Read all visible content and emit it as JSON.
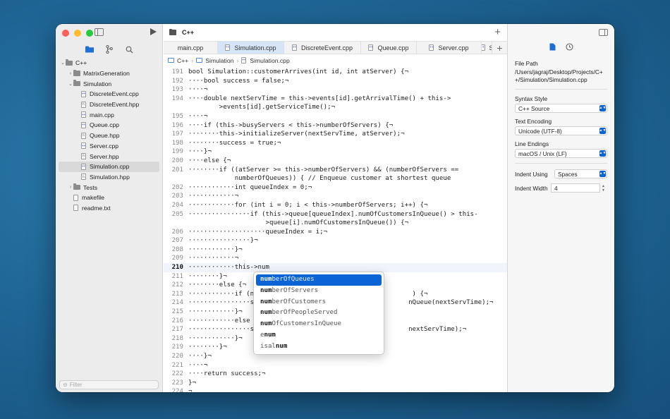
{
  "sidebar": {
    "filter_placeholder": "Filter",
    "tree": [
      {
        "label": "C++",
        "indent": 0,
        "chev": "⌄",
        "type": "folder",
        "name": "tree-folder-cpp"
      },
      {
        "label": "MatrixGeneration",
        "indent": 1,
        "chev": "›",
        "type": "folder",
        "name": "tree-folder-matrixgeneration"
      },
      {
        "label": "Simulation",
        "indent": 1,
        "chev": "⌄",
        "type": "folder",
        "name": "tree-folder-simulation"
      },
      {
        "label": "DiscreteEvent.cpp",
        "indent": 2,
        "type": "cpp",
        "name": "tree-file-discreteevent-cpp"
      },
      {
        "label": "DiscreteEvent.hpp",
        "indent": 2,
        "type": "h",
        "name": "tree-file-discreteevent-hpp"
      },
      {
        "label": "main.cpp",
        "indent": 2,
        "type": "cpp",
        "name": "tree-file-main-cpp"
      },
      {
        "label": "Queue.cpp",
        "indent": 2,
        "type": "cpp",
        "name": "tree-file-queue-cpp"
      },
      {
        "label": "Queue.hpp",
        "indent": 2,
        "type": "h",
        "name": "tree-file-queue-hpp"
      },
      {
        "label": "Server.cpp",
        "indent": 2,
        "type": "cpp",
        "name": "tree-file-server-cpp"
      },
      {
        "label": "Server.hpp",
        "indent": 2,
        "type": "h",
        "name": "tree-file-server-hpp"
      },
      {
        "label": "Simulation.cpp",
        "indent": 2,
        "type": "cpp",
        "selected": true,
        "name": "tree-file-simulation-cpp"
      },
      {
        "label": "Simulation.hpp",
        "indent": 2,
        "type": "h",
        "name": "tree-file-simulation-hpp"
      },
      {
        "label": "Tests",
        "indent": 1,
        "chev": "›",
        "type": "folder",
        "name": "tree-folder-tests"
      },
      {
        "label": "makefile",
        "indent": 1,
        "type": "plain",
        "name": "tree-file-makefile"
      },
      {
        "label": "readme.txt",
        "indent": 1,
        "type": "plain",
        "name": "tree-file-readme"
      }
    ]
  },
  "editor": {
    "project_title": "C++",
    "tabs": [
      {
        "label": "main.cpp",
        "width": 77,
        "active": false,
        "icon": false
      },
      {
        "label": "Simulation.cpp",
        "width": 94,
        "active": true,
        "icon": true
      },
      {
        "label": "DiscreteEvent.cpp",
        "width": 109,
        "active": false,
        "icon": true
      },
      {
        "label": "Queue.cpp",
        "width": 79,
        "active": false,
        "icon": true
      },
      {
        "label": "Server.cpp",
        "width": 92,
        "active": false,
        "icon": true
      },
      {
        "label": "S",
        "width": 15,
        "active": false,
        "icon": true
      }
    ],
    "breadcrumb": [
      "C++",
      "Simulation",
      "Simulation.cpp"
    ],
    "current_line": "210",
    "lines": [
      {
        "n": "191",
        "t": "bool Simulation::customerArrives(int id, int atServer) {¬"
      },
      {
        "n": "192",
        "t": "····bool success = false;¬"
      },
      {
        "n": "193",
        "t": "····¬"
      },
      {
        "n": "194",
        "t": "····double nextServTime = this->events[id].getArrivalTime() + this->"
      },
      {
        "n": "",
        "t": "        >events[id].getServiceTime();¬"
      },
      {
        "n": "195",
        "t": "····¬"
      },
      {
        "n": "196",
        "t": "····if (this->busyServers < this->numberOfServers) {¬"
      },
      {
        "n": "197",
        "t": "········this->initializeServer(nextServTime, atServer);¬"
      },
      {
        "n": "198",
        "t": "········success = true;¬"
      },
      {
        "n": "199",
        "t": "····}¬"
      },
      {
        "n": "200",
        "t": "····else {¬"
      },
      {
        "n": "201",
        "t": "········if ((atServer >= this->numberOfServers) && (numberOfServers =="
      },
      {
        "n": "",
        "t": "            numberOfQueues)) { // Enqueue customer at shortest queue"
      },
      {
        "n": "202",
        "t": "············int queueIndex = 0;¬"
      },
      {
        "n": "203",
        "t": "············¬"
      },
      {
        "n": "204",
        "t": "············for (int i = 0; i < this->numberOfServers; i++) {¬"
      },
      {
        "n": "205",
        "t": "················if (this->queue[queueIndex].numOfCustomersInQueue() > this-"
      },
      {
        "n": "",
        "t": "                    >queue[i].numOfCustomersInQueue()) {¬"
      },
      {
        "n": "206",
        "t": "····················queueIndex = i;¬"
      },
      {
        "n": "207",
        "t": "················}¬"
      },
      {
        "n": "208",
        "t": "············}¬"
      },
      {
        "n": "209",
        "t": "············¬"
      },
      {
        "n": "210",
        "t": "············this->num"
      },
      {
        "n": "211",
        "t": "········}¬"
      },
      {
        "n": "212",
        "t": "········else {¬"
      },
      {
        "n": "213",
        "t": "············if (n                                         ) {¬"
      },
      {
        "n": "214",
        "t": "················s                                        nQueue(nextServTime);¬"
      },
      {
        "n": "215",
        "t": "············}¬"
      },
      {
        "n": "216",
        "t": "············else"
      },
      {
        "n": "217",
        "t": "················s                                        nextServTime);¬"
      },
      {
        "n": "218",
        "t": "············}¬"
      },
      {
        "n": "219",
        "t": "········}¬"
      },
      {
        "n": "220",
        "t": "····}¬"
      },
      {
        "n": "221",
        "t": "····¬"
      },
      {
        "n": "222",
        "t": "····return success;¬"
      },
      {
        "n": "223",
        "t": "}¬"
      },
      {
        "n": "224",
        "t": "¬"
      }
    ],
    "autocomplete": [
      {
        "match": "num",
        "rest": "berOfQueues",
        "selected": true
      },
      {
        "match": "num",
        "rest": "berOfServers"
      },
      {
        "match": "num",
        "rest": "berOfCustomers"
      },
      {
        "match": "num",
        "rest": "berOfPeopleServed"
      },
      {
        "match": "num",
        "rest": "OfCustomersInQueue"
      },
      {
        "pre": "e",
        "match": "num",
        "rest": ""
      },
      {
        "pre": "isal",
        "match": "num",
        "rest": ""
      }
    ]
  },
  "inspector": {
    "file_path_label": "File Path",
    "file_path_value": "/Users/jagraj/Desktop/Projects/C++/Simulation/Simulation.cpp",
    "syntax_style_label": "Syntax Style",
    "syntax_style_value": "C++ Source",
    "text_encoding_label": "Text Encoding",
    "text_encoding_value": "Unicode (UTF-8)",
    "line_endings_label": "Line Endings",
    "line_endings_value": "macOS / Unix (LF)",
    "indent_using_label": "Indent Using",
    "indent_using_value": "Spaces",
    "indent_width_label": "Indent Width",
    "indent_width_value": "4"
  },
  "colors": {
    "accent": "#0a64d6",
    "keyword": "#b01d8f",
    "function": "#3262a8",
    "comment": "#6a8a3a",
    "selected_tab": "#d6e4f7"
  }
}
